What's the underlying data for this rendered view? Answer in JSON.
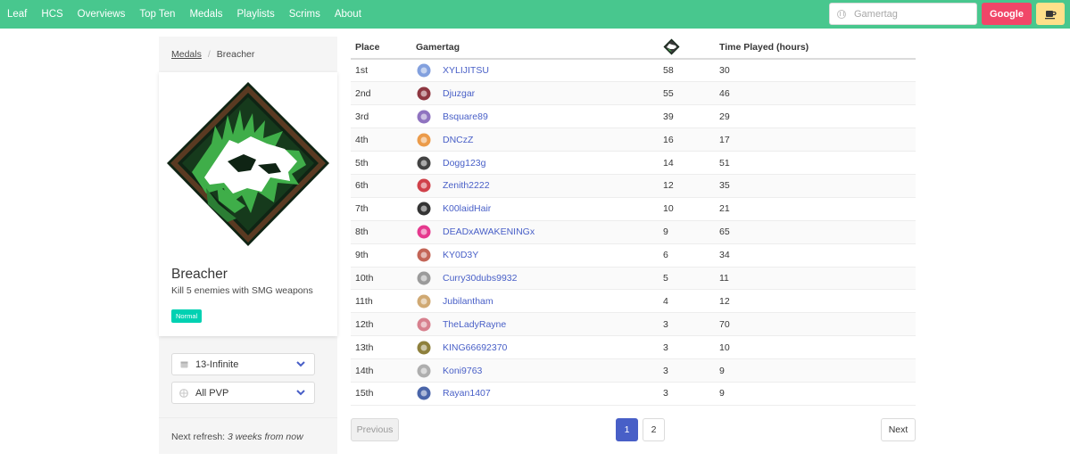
{
  "nav": {
    "items": [
      "Leaf",
      "HCS",
      "Overviews",
      "Top Ten",
      "Medals",
      "Playlists",
      "Scrims",
      "About"
    ],
    "search_placeholder": "Gamertag",
    "google_label": "Google",
    "coffee_icon": "coffee-icon"
  },
  "breadcrumb": {
    "parent": "Medals",
    "current": "Breacher"
  },
  "medal": {
    "name": "Breacher",
    "description": "Kill 5 enemies with SMG weapons",
    "difficulty": "Normal",
    "icon": "breacher-medal-icon",
    "colors": {
      "frame": "#5a3a22",
      "green": "#3fae49",
      "dark": "#0f2414"
    }
  },
  "filters": {
    "season": {
      "icon": "calendar-icon",
      "value": "13-Infinite"
    },
    "playlist": {
      "icon": "globe-icon",
      "value": "All PVP"
    }
  },
  "refresh": {
    "label": "Next refresh:",
    "value": "3 weeks from now"
  },
  "table": {
    "headers": {
      "place": "Place",
      "gamertag": "Gamertag",
      "medal_icon": "breacher-medal-small-icon",
      "time": "Time Played (hours)"
    },
    "rows": [
      {
        "place": "1st",
        "gamertag": "XYLIJITSU",
        "count": "58",
        "time": "30",
        "emblem_color": "#6c8fd8"
      },
      {
        "place": "2nd",
        "gamertag": "Djuzgar",
        "count": "55",
        "time": "46",
        "emblem_color": "#7a1420"
      },
      {
        "place": "3rd",
        "gamertag": "Bsquare89",
        "count": "39",
        "time": "29",
        "emblem_color": "#7b5bb5"
      },
      {
        "place": "4th",
        "gamertag": "DNCzZ",
        "count": "16",
        "time": "17",
        "emblem_color": "#e88a2a"
      },
      {
        "place": "5th",
        "gamertag": "Dogg123g",
        "count": "14",
        "time": "51",
        "emblem_color": "#222222"
      },
      {
        "place": "6th",
        "gamertag": "Zenith2222",
        "count": "12",
        "time": "35",
        "emblem_color": "#c8202a"
      },
      {
        "place": "7th",
        "gamertag": "K00laidHair",
        "count": "10",
        "time": "21",
        "emblem_color": "#111111"
      },
      {
        "place": "8th",
        "gamertag": "DEADxAWAKENINGx",
        "count": "9",
        "time": "65",
        "emblem_color": "#e0167a"
      },
      {
        "place": "9th",
        "gamertag": "KY0D3Y",
        "count": "6",
        "time": "34",
        "emblem_color": "#b84a3a"
      },
      {
        "place": "10th",
        "gamertag": "Curry30dubs9932",
        "count": "5",
        "time": "11",
        "emblem_color": "#8a8a8a"
      },
      {
        "place": "11th",
        "gamertag": "Jubilantham",
        "count": "4",
        "time": "12",
        "emblem_color": "#c89a5a"
      },
      {
        "place": "12th",
        "gamertag": "TheLadyRayne",
        "count": "3",
        "time": "70",
        "emblem_color": "#d06a7a"
      },
      {
        "place": "13th",
        "gamertag": "KING66692370",
        "count": "3",
        "time": "10",
        "emblem_color": "#7a6a1a"
      },
      {
        "place": "14th",
        "gamertag": "Koni9763",
        "count": "3",
        "time": "9",
        "emblem_color": "#a0a0a0"
      },
      {
        "place": "15th",
        "gamertag": "Rayan1407",
        "count": "3",
        "time": "9",
        "emblem_color": "#2a4a9a"
      }
    ]
  },
  "pagination": {
    "previous": "Previous",
    "pages": [
      "1",
      "2"
    ],
    "current": "1",
    "next": "Next"
  }
}
